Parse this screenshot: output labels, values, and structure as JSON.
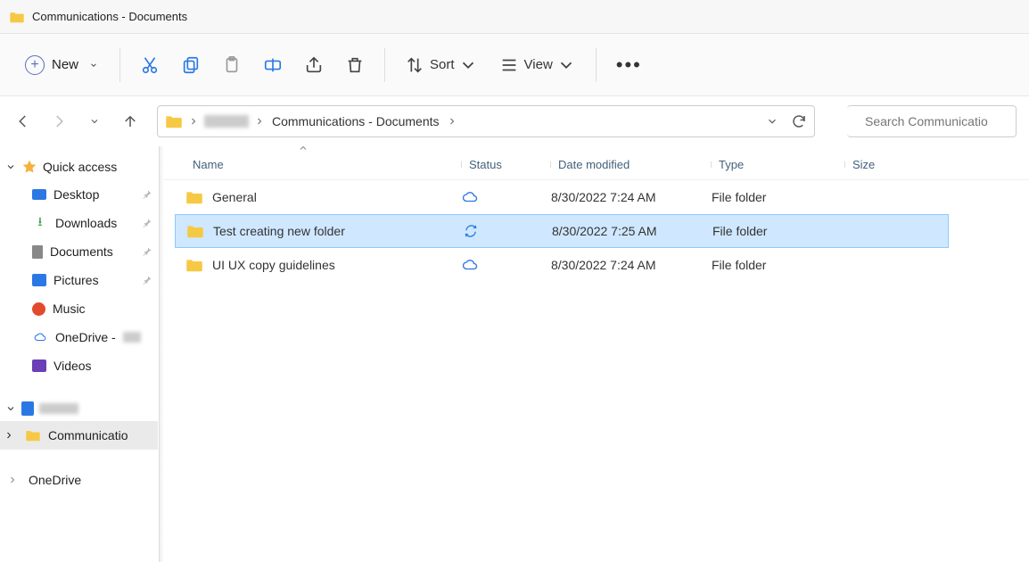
{
  "window": {
    "title": "Communications - Documents"
  },
  "toolbar": {
    "new_label": "New",
    "sort_label": "Sort",
    "view_label": "View"
  },
  "breadcrumb": {
    "current": "Communications - Documents"
  },
  "search": {
    "placeholder": "Search Communicatio"
  },
  "sidebar": {
    "quick_access": "Quick access",
    "items": [
      {
        "label": "Desktop",
        "pinned": true
      },
      {
        "label": "Downloads",
        "pinned": true
      },
      {
        "label": "Documents",
        "pinned": true
      },
      {
        "label": "Pictures",
        "pinned": true
      },
      {
        "label": "Music",
        "pinned": false
      },
      {
        "label": "OneDrive - ",
        "pinned": false
      },
      {
        "label": "Videos",
        "pinned": false
      }
    ],
    "group2_item": "Communicatio",
    "group3_item": "OneDrive"
  },
  "columns": {
    "name": "Name",
    "status": "Status",
    "date": "Date modified",
    "type": "Type",
    "size": "Size"
  },
  "rows": [
    {
      "name": "General",
      "status": "cloud",
      "date": "8/30/2022 7:24 AM",
      "type": "File folder",
      "size": ""
    },
    {
      "name": "Test creating new folder",
      "status": "sync",
      "date": "8/30/2022 7:25 AM",
      "type": "File folder",
      "size": "",
      "selected": true
    },
    {
      "name": "UI UX copy guidelines",
      "status": "cloud",
      "date": "8/30/2022 7:24 AM",
      "type": "File folder",
      "size": ""
    }
  ]
}
